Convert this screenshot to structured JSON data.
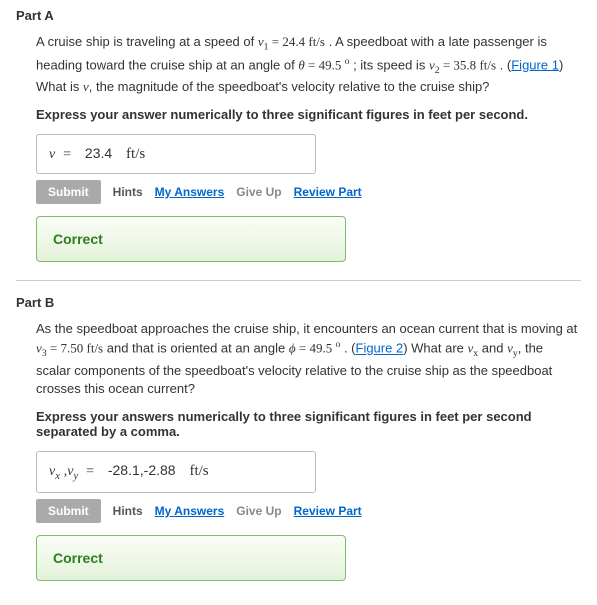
{
  "partA": {
    "title": "Part A",
    "prompt_text1": "A cruise ship is traveling at a speed of ",
    "v1_sym": "v",
    "v1_sub": "1",
    "eq1": " = 24.4 ",
    "unit1": "ft/s",
    "prompt_text2": " . A speedboat with a late passenger is heading toward the cruise ship at an angle of ",
    "theta_sym": "θ",
    "eq2": " = 49.5 ",
    "deg": "o",
    "prompt_text3": " ; its speed is ",
    "v2_sym": "v",
    "v2_sub": "2",
    "eq3": " = 35.8 ",
    "unit2": "ft/s",
    "prompt_text4": " . (",
    "figlink": "Figure 1",
    "prompt_text5": ") What is ",
    "v_sym": "v",
    "prompt_text6": ", the magnitude of the speedboat's velocity relative to the cruise ship?",
    "instruction": "Express your answer numerically to three significant figures in feet per second.",
    "answer_lhs": "v",
    "answer_eq": "=",
    "answer_val": "23.4",
    "answer_unit": "ft/s",
    "submit": "Submit",
    "hints": "Hints",
    "myanswers": "My Answers",
    "giveup": "Give Up",
    "review": "Review Part",
    "correct": "Correct"
  },
  "partB": {
    "title": "Part B",
    "prompt_text1": "As the speedboat approaches the cruise ship, it encounters an ocean current that is moving at ",
    "v3_sym": "v",
    "v3_sub": "3",
    "eq1": " = 7.50 ",
    "unit1": "ft/s",
    "prompt_text2": " and that is oriented at an angle ",
    "phi_sym": "ϕ",
    "eq2": " = 49.5 ",
    "deg": "o",
    "prompt_text3": " . (",
    "figlink": "Figure 2",
    "prompt_text4": ") What are ",
    "vx_sym": "v",
    "vx_sub": "x",
    "and": " and ",
    "vy_sym": "v",
    "vy_sub": "y",
    "prompt_text5": ", the scalar components of the speedboat's velocity relative to the cruise ship as the speedboat crosses this ocean current?",
    "instruction": "Express your answers numerically to three significant figures in feet per second separated by a comma.",
    "answer_lhs1": "v",
    "answer_sub1": "x",
    "comma": ",",
    "answer_lhs2": "v",
    "answer_sub2": "y",
    "answer_eq": "=",
    "answer_val": "-28.1,-2.88",
    "answer_unit": "ft/s",
    "submit": "Submit",
    "hints": "Hints",
    "myanswers": "My Answers",
    "giveup": "Give Up",
    "review": "Review Part",
    "correct": "Correct"
  }
}
